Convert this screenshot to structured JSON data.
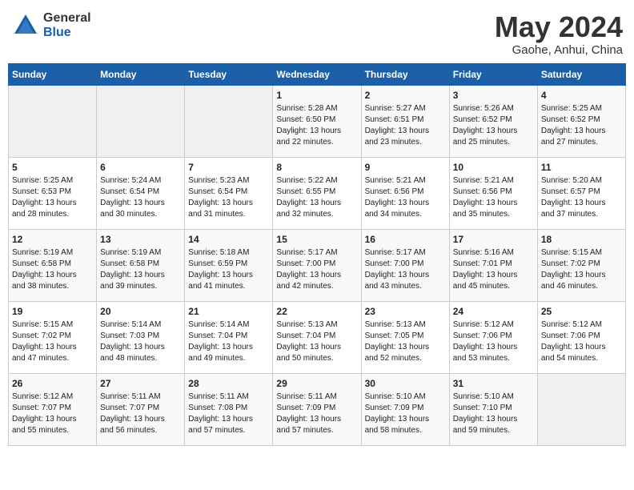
{
  "header": {
    "logo_general": "General",
    "logo_blue": "Blue",
    "month_year": "May 2024",
    "location": "Gaohe, Anhui, China"
  },
  "days_of_week": [
    "Sunday",
    "Monday",
    "Tuesday",
    "Wednesday",
    "Thursday",
    "Friday",
    "Saturday"
  ],
  "weeks": [
    [
      {
        "day": "",
        "info": ""
      },
      {
        "day": "",
        "info": ""
      },
      {
        "day": "",
        "info": ""
      },
      {
        "day": "1",
        "info": "Sunrise: 5:28 AM\nSunset: 6:50 PM\nDaylight: 13 hours\nand 22 minutes."
      },
      {
        "day": "2",
        "info": "Sunrise: 5:27 AM\nSunset: 6:51 PM\nDaylight: 13 hours\nand 23 minutes."
      },
      {
        "day": "3",
        "info": "Sunrise: 5:26 AM\nSunset: 6:52 PM\nDaylight: 13 hours\nand 25 minutes."
      },
      {
        "day": "4",
        "info": "Sunrise: 5:25 AM\nSunset: 6:52 PM\nDaylight: 13 hours\nand 27 minutes."
      }
    ],
    [
      {
        "day": "5",
        "info": "Sunrise: 5:25 AM\nSunset: 6:53 PM\nDaylight: 13 hours\nand 28 minutes."
      },
      {
        "day": "6",
        "info": "Sunrise: 5:24 AM\nSunset: 6:54 PM\nDaylight: 13 hours\nand 30 minutes."
      },
      {
        "day": "7",
        "info": "Sunrise: 5:23 AM\nSunset: 6:54 PM\nDaylight: 13 hours\nand 31 minutes."
      },
      {
        "day": "8",
        "info": "Sunrise: 5:22 AM\nSunset: 6:55 PM\nDaylight: 13 hours\nand 32 minutes."
      },
      {
        "day": "9",
        "info": "Sunrise: 5:21 AM\nSunset: 6:56 PM\nDaylight: 13 hours\nand 34 minutes."
      },
      {
        "day": "10",
        "info": "Sunrise: 5:21 AM\nSunset: 6:56 PM\nDaylight: 13 hours\nand 35 minutes."
      },
      {
        "day": "11",
        "info": "Sunrise: 5:20 AM\nSunset: 6:57 PM\nDaylight: 13 hours\nand 37 minutes."
      }
    ],
    [
      {
        "day": "12",
        "info": "Sunrise: 5:19 AM\nSunset: 6:58 PM\nDaylight: 13 hours\nand 38 minutes."
      },
      {
        "day": "13",
        "info": "Sunrise: 5:19 AM\nSunset: 6:58 PM\nDaylight: 13 hours\nand 39 minutes."
      },
      {
        "day": "14",
        "info": "Sunrise: 5:18 AM\nSunset: 6:59 PM\nDaylight: 13 hours\nand 41 minutes."
      },
      {
        "day": "15",
        "info": "Sunrise: 5:17 AM\nSunset: 7:00 PM\nDaylight: 13 hours\nand 42 minutes."
      },
      {
        "day": "16",
        "info": "Sunrise: 5:17 AM\nSunset: 7:00 PM\nDaylight: 13 hours\nand 43 minutes."
      },
      {
        "day": "17",
        "info": "Sunrise: 5:16 AM\nSunset: 7:01 PM\nDaylight: 13 hours\nand 45 minutes."
      },
      {
        "day": "18",
        "info": "Sunrise: 5:15 AM\nSunset: 7:02 PM\nDaylight: 13 hours\nand 46 minutes."
      }
    ],
    [
      {
        "day": "19",
        "info": "Sunrise: 5:15 AM\nSunset: 7:02 PM\nDaylight: 13 hours\nand 47 minutes."
      },
      {
        "day": "20",
        "info": "Sunrise: 5:14 AM\nSunset: 7:03 PM\nDaylight: 13 hours\nand 48 minutes."
      },
      {
        "day": "21",
        "info": "Sunrise: 5:14 AM\nSunset: 7:04 PM\nDaylight: 13 hours\nand 49 minutes."
      },
      {
        "day": "22",
        "info": "Sunrise: 5:13 AM\nSunset: 7:04 PM\nDaylight: 13 hours\nand 50 minutes."
      },
      {
        "day": "23",
        "info": "Sunrise: 5:13 AM\nSunset: 7:05 PM\nDaylight: 13 hours\nand 52 minutes."
      },
      {
        "day": "24",
        "info": "Sunrise: 5:12 AM\nSunset: 7:06 PM\nDaylight: 13 hours\nand 53 minutes."
      },
      {
        "day": "25",
        "info": "Sunrise: 5:12 AM\nSunset: 7:06 PM\nDaylight: 13 hours\nand 54 minutes."
      }
    ],
    [
      {
        "day": "26",
        "info": "Sunrise: 5:12 AM\nSunset: 7:07 PM\nDaylight: 13 hours\nand 55 minutes."
      },
      {
        "day": "27",
        "info": "Sunrise: 5:11 AM\nSunset: 7:07 PM\nDaylight: 13 hours\nand 56 minutes."
      },
      {
        "day": "28",
        "info": "Sunrise: 5:11 AM\nSunset: 7:08 PM\nDaylight: 13 hours\nand 57 minutes."
      },
      {
        "day": "29",
        "info": "Sunrise: 5:11 AM\nSunset: 7:09 PM\nDaylight: 13 hours\nand 57 minutes."
      },
      {
        "day": "30",
        "info": "Sunrise: 5:10 AM\nSunset: 7:09 PM\nDaylight: 13 hours\nand 58 minutes."
      },
      {
        "day": "31",
        "info": "Sunrise: 5:10 AM\nSunset: 7:10 PM\nDaylight: 13 hours\nand 59 minutes."
      },
      {
        "day": "",
        "info": ""
      }
    ]
  ]
}
